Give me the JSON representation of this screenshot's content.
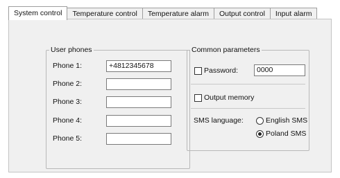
{
  "tabs": [
    {
      "label": "System control",
      "active": true
    },
    {
      "label": "Temperature control",
      "active": false
    },
    {
      "label": "Temperature alarm",
      "active": false
    },
    {
      "label": "Output control",
      "active": false
    },
    {
      "label": "Input alarm",
      "active": false
    }
  ],
  "user_phones": {
    "legend": "User phones",
    "phones": [
      {
        "label": "Phone 1:",
        "value": "+4812345678"
      },
      {
        "label": "Phone 2:",
        "value": ""
      },
      {
        "label": "Phone 3:",
        "value": ""
      },
      {
        "label": "Phone 4:",
        "value": ""
      },
      {
        "label": "Phone 5:",
        "value": ""
      }
    ]
  },
  "common_parameters": {
    "legend": "Common parameters",
    "password": {
      "label": "Password:",
      "checked": false,
      "value": "0000"
    },
    "output_memory": {
      "label": "Output memory",
      "checked": false
    },
    "sms_language": {
      "label": "SMS language:",
      "options": [
        {
          "label": "English SMS",
          "selected": false
        },
        {
          "label": "Poland SMS",
          "selected": true
        }
      ]
    }
  }
}
